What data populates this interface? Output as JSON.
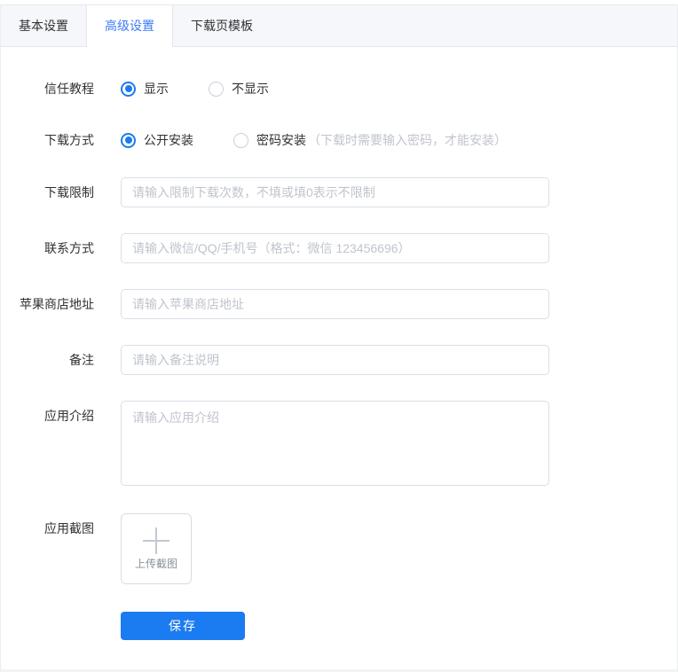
{
  "colors": {
    "accent": "#1b7bf0",
    "tab_active_text": "#3e7bf7",
    "input_border": "#dcdfe6",
    "tab_header_bg": "#f5f7fa",
    "placeholder_text": "#bfc4cd"
  },
  "tabs": {
    "items": [
      {
        "label": "基本设置",
        "active": false
      },
      {
        "label": "高级设置",
        "active": true
      },
      {
        "label": "下载页模板",
        "active": false
      }
    ]
  },
  "form": {
    "trust_tutorial": {
      "label": "信任教程",
      "options": [
        {
          "label": "显示",
          "selected": true
        },
        {
          "label": "不显示",
          "selected": false
        }
      ]
    },
    "download_method": {
      "label": "下载方式",
      "options": [
        {
          "label": "公开安装",
          "selected": true
        },
        {
          "label": "密码安装",
          "selected": false,
          "hint": "（下载时需要输入密码，才能安装）"
        }
      ]
    },
    "download_limit": {
      "label": "下载限制",
      "value": "",
      "placeholder": "请输入限制下载次数，不填或填0表示不限制"
    },
    "contact": {
      "label": "联系方式",
      "value": "",
      "placeholder": "请输入微信/QQ/手机号（格式：微信 123456696）"
    },
    "apple_store": {
      "label": "苹果商店地址",
      "value": "",
      "placeholder": "请输入苹果商店地址"
    },
    "remark": {
      "label": "备注",
      "value": "",
      "placeholder": "请输入备注说明"
    },
    "app_intro": {
      "label": "应用介绍",
      "value": "",
      "placeholder": "请输入应用介绍"
    },
    "app_screenshot": {
      "label": "应用截图",
      "upload_text": "上传截图",
      "icon": "plus-icon"
    },
    "save_label": "保存"
  }
}
